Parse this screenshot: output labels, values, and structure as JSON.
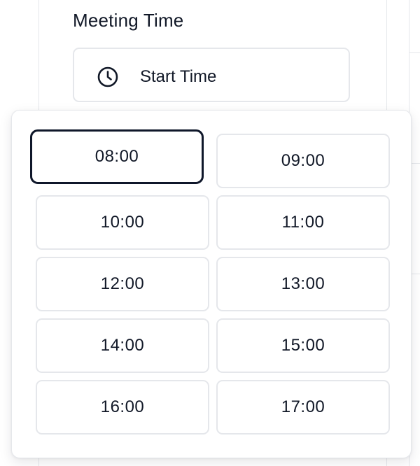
{
  "section": {
    "title": "Meeting Time"
  },
  "start_trigger": {
    "icon": "clock-icon",
    "label": "Start Time"
  },
  "time_picker": {
    "focused_index": 0,
    "slots": [
      "08:00",
      "09:00",
      "10:00",
      "11:00",
      "12:00",
      "13:00",
      "14:00",
      "15:00",
      "16:00",
      "17:00"
    ]
  },
  "colors": {
    "border": "#e5e7eb",
    "focus_ring": "#0f172a",
    "text": "#111827"
  }
}
